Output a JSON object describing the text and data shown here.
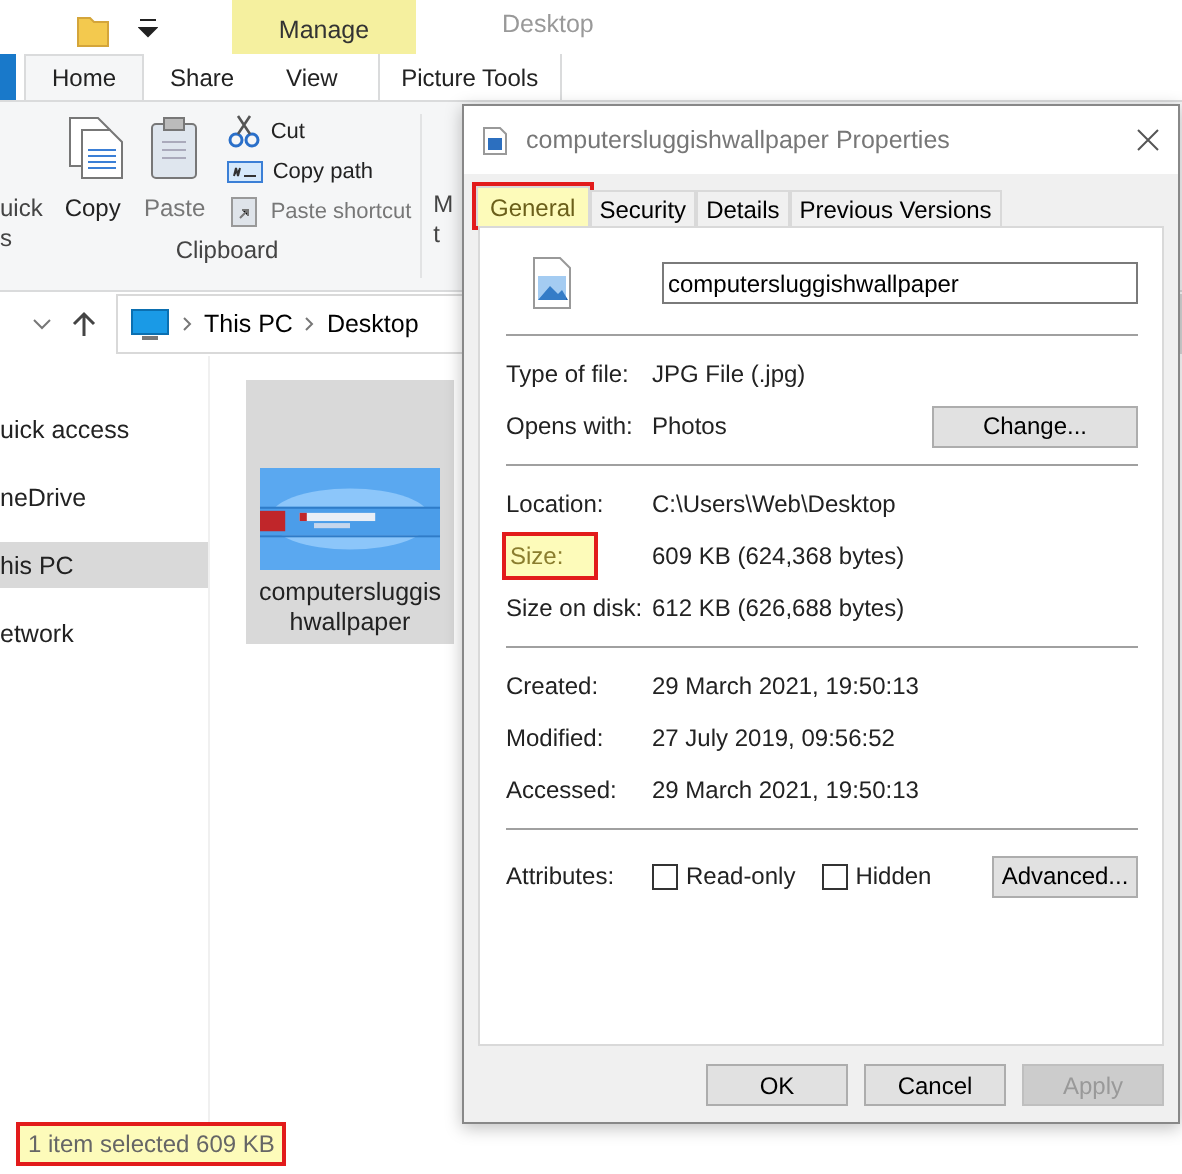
{
  "explorer": {
    "title": "Desktop",
    "context_header": "Manage",
    "ribbon_tabs": [
      {
        "label": "Home",
        "selected": true
      },
      {
        "label": "Share",
        "selected": false
      },
      {
        "label": "View",
        "selected": false
      },
      {
        "label": "Picture Tools",
        "selected": false
      }
    ],
    "ribbon": {
      "pin_lines": [
        "uick",
        "s"
      ],
      "large_buttons": [
        {
          "kind": "copy",
          "label": "Copy",
          "disabled": false
        },
        {
          "kind": "paste",
          "label": "Paste",
          "disabled": true
        }
      ],
      "small_buttons": [
        {
          "kind": "cut",
          "label": "Cut",
          "disabled": false
        },
        {
          "kind": "copypath",
          "label": "Copy path",
          "disabled": false
        },
        {
          "kind": "shortcut",
          "label": "Paste shortcut",
          "disabled": true
        }
      ],
      "group_label": "Clipboard",
      "move_lines": [
        "M",
        "t"
      ]
    },
    "address": [
      "This PC",
      "Desktop"
    ],
    "nav": [
      {
        "label": "uick access",
        "selected": false
      },
      {
        "label": "neDrive",
        "selected": false
      },
      {
        "label": "his PC",
        "selected": true
      },
      {
        "label": "etwork",
        "selected": false
      }
    ],
    "files": [
      {
        "name": "computersluggishwallpaper",
        "selected": true
      }
    ],
    "status": {
      "text": "1 item selected  609 KB",
      "highlighted": true
    }
  },
  "dialog": {
    "title": "computersluggishwallpaper Properties",
    "tabs": [
      {
        "label": "General",
        "selected": true,
        "highlighted": true
      },
      {
        "label": "Security",
        "selected": false,
        "highlighted": false
      },
      {
        "label": "Details",
        "selected": false,
        "highlighted": false
      },
      {
        "label": "Previous Versions",
        "selected": false,
        "highlighted": false
      }
    ],
    "name": "computersluggishwallpaper",
    "groups": [
      [
        {
          "label": "Type of file:",
          "value": "JPG File (.jpg)",
          "highlighted": false
        },
        {
          "label": "Opens with:",
          "value": "Photos",
          "button": "Change...",
          "highlighted": false
        }
      ],
      [
        {
          "label": "Location:",
          "value": "C:\\Users\\Web\\Desktop",
          "highlighted": false
        },
        {
          "label": "Size:",
          "value": "609 KB (624,368 bytes)",
          "highlighted": true
        },
        {
          "label": "Size on disk:",
          "value": "612 KB (626,688 bytes)",
          "highlighted": false
        }
      ],
      [
        {
          "label": "Created:",
          "value": "29 March 2021, 19:50:13",
          "highlighted": false
        },
        {
          "label": "Modified:",
          "value": "27 July 2019, 09:56:52",
          "highlighted": false
        },
        {
          "label": "Accessed:",
          "value": "29 March 2021, 19:50:13",
          "highlighted": false
        }
      ]
    ],
    "attributes": {
      "label": "Attributes:",
      "checks": [
        {
          "label": "Read-only",
          "checked": false
        },
        {
          "label": "Hidden",
          "checked": false
        }
      ],
      "button": "Advanced..."
    },
    "buttons": [
      {
        "label": "OK",
        "disabled": false
      },
      {
        "label": "Cancel",
        "disabled": false
      },
      {
        "label": "Apply",
        "disabled": true
      }
    ]
  }
}
